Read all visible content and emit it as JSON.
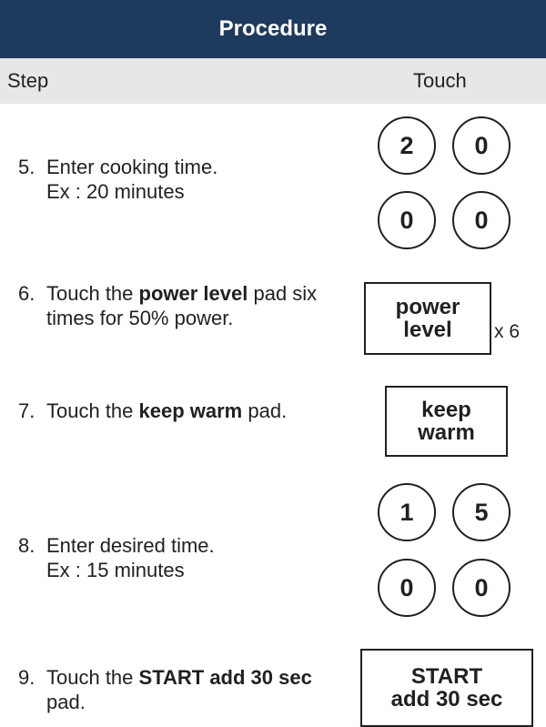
{
  "header": {
    "title": "Procedure"
  },
  "columns": {
    "step": "Step",
    "touch": "Touch"
  },
  "steps": [
    {
      "num": "5.",
      "line1": "Enter cooking time.",
      "line2": "Ex : 20 minutes",
      "keys": [
        "2",
        "0",
        "0",
        "0"
      ]
    },
    {
      "num": "6.",
      "pre": "Touch the ",
      "bold": "power level",
      "post": " pad six times for 50% power.",
      "pad": [
        "power",
        "level"
      ],
      "multiplier": "x 6"
    },
    {
      "num": "7.",
      "pre": "Touch the ",
      "bold": "keep warm",
      "post": " pad.",
      "pad": [
        "keep",
        "warm"
      ]
    },
    {
      "num": "8.",
      "line1": "Enter desired time.",
      "line2": "Ex : 15 minutes",
      "keys": [
        "1",
        "5",
        "0",
        "0"
      ]
    },
    {
      "num": "9.",
      "pre": "Touch the ",
      "bold": "START add 30 sec",
      "post": " pad.",
      "pad": [
        "START",
        "add 30 sec"
      ]
    }
  ],
  "colors": {
    "header_bg": "#1f3a5f",
    "subheader_bg": "#e6e7e8",
    "text": "#231f20"
  }
}
